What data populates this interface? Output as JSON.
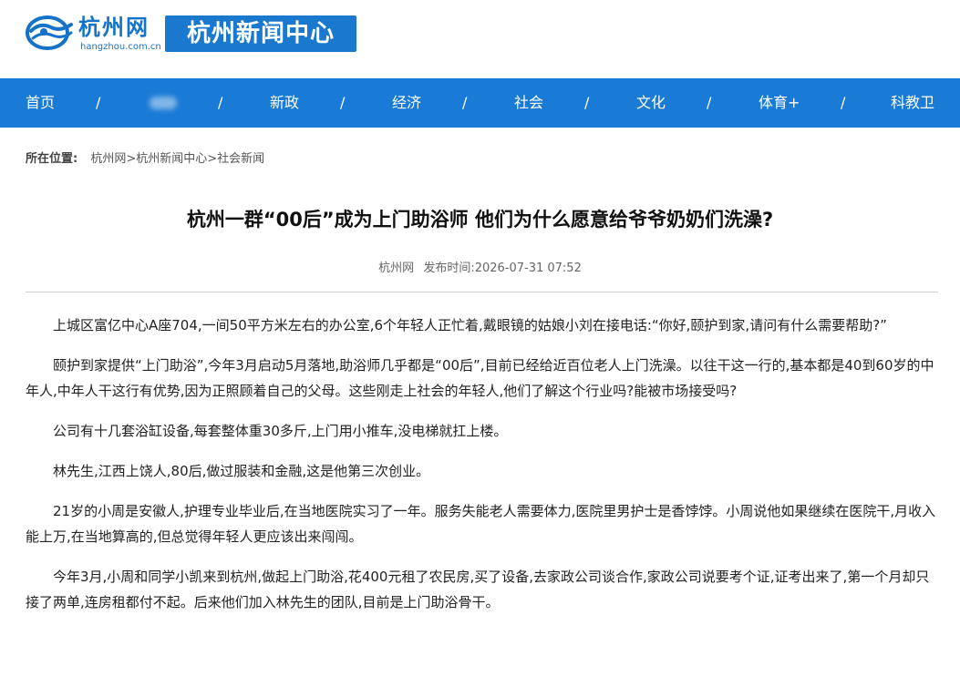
{
  "site": {
    "logo_cn": "杭州网",
    "logo_en": "hangzhou.com.cn",
    "center": "杭州新闻中心"
  },
  "nav": {
    "items": [
      "首页",
      "新政",
      "经济",
      "社会",
      "文化",
      "体育+",
      "科教卫"
    ],
    "separator": "/"
  },
  "breadcrumb": {
    "label": "所在位置:",
    "path": "杭州网>杭州新闻中心>社会新闻"
  },
  "article": {
    "title": "杭州一群“00后”成为上门助浴师 他们为什么愿意给爷爷奶奶们洗澡?",
    "source": "杭州网",
    "published": "发布时间:2026-07-31 07:52",
    "paragraphs": [
      "上城区富亿中心A座704,一间50平方米左右的办公室,6个年轻人正忙着,戴眼镜的姑娘小刘在接电话:“你好,颐护到家,请问有什么需要帮助?”",
      "颐护到家提供“上门助浴”,今年3月启动5月落地,助浴师几乎都是“00后”,目前已经给近百位老人上门洗澡。以往干这一行的,基本都是40到60岁的中年人,中年人干这行有优势,因为正照顾着自己的父母。这些刚走上社会的年轻人,他们了解这个行业吗?能被市场接受吗?",
      "公司有十几套浴缸设备,每套整体重30多斤,上门用小推车,没电梯就扛上楼。",
      "林先生,江西上饶人,80后,做过服装和金融,这是他第三次创业。",
      "21岁的小周是安徽人,护理专业毕业后,在当地医院实习了一年。服务失能老人需要体力,医院里男护士是香饽饽。小周说他如果继续在医院干,月收入能上万,在当地算高的,但总觉得年轻人更应该出来闯闯。",
      "今年3月,小周和同学小凯来到杭州,做起上门助浴,花400元租了农民房,买了设备,去家政公司谈合作,家政公司说要考个证,证考出来了,第一个月却只接了两单,连房租都付不起。后来他们加入林先生的团队,目前是上门助浴骨干。"
    ]
  },
  "colors": {
    "nav_bg": "#1a7bd6",
    "badge_bg": "#1b78cf",
    "logo_blue": "#1473c8"
  }
}
